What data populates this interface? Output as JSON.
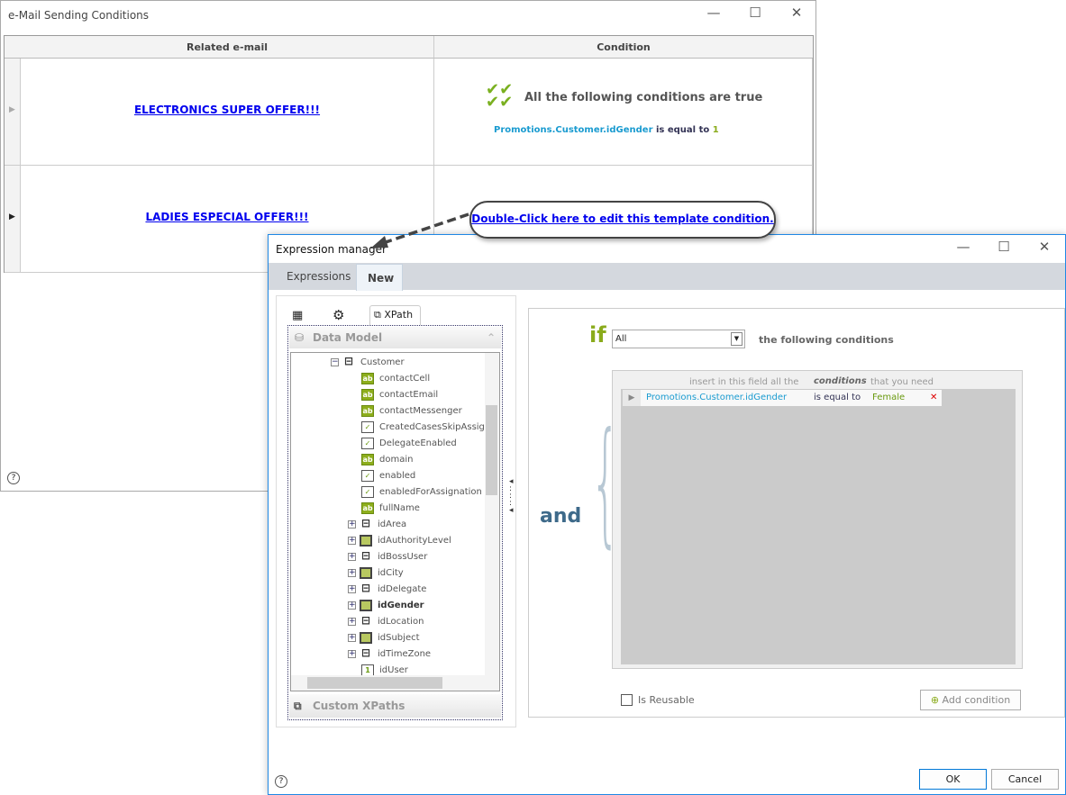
{
  "window1": {
    "title": "e-Mail Sending Conditions",
    "columns": [
      "Related e-mail",
      "Condition"
    ],
    "rows": [
      {
        "email": "ELECTRONICS SUPER OFFER!!!",
        "condition_title": "All the following conditions are true",
        "cond_field": "Promotions.Customer.idGender",
        "cond_op": "is equal to",
        "cond_value": "1"
      },
      {
        "email": "LADIES ESPECIAL OFFER!!!",
        "condition_link": "Double-Click here to edit this template condition."
      }
    ],
    "help": "?"
  },
  "window2": {
    "title": "Expression manager",
    "tabs": [
      "Expressions",
      "New"
    ],
    "active_tab": "New",
    "left_tabs": {
      "xpath": "XPath"
    },
    "data_model": "Data Model",
    "custom_xpaths": "Custom XPaths",
    "tree": {
      "root": "Customer",
      "items": [
        {
          "label": "contactCell",
          "icon": "ab"
        },
        {
          "label": "contactEmail",
          "icon": "ab"
        },
        {
          "label": "contactMessenger",
          "icon": "ab"
        },
        {
          "label": "CreatedCasesSkipAssigR",
          "icon": "check"
        },
        {
          "label": "DelegateEnabled",
          "icon": "check"
        },
        {
          "label": "domain",
          "icon": "ab"
        },
        {
          "label": "enabled",
          "icon": "check"
        },
        {
          "label": "enabledForAssignation",
          "icon": "check"
        },
        {
          "label": "fullName",
          "icon": "ab"
        },
        {
          "label": "idArea",
          "icon": "relation",
          "expandable": true
        },
        {
          "label": "idAuthorityLevel",
          "icon": "table",
          "expandable": true
        },
        {
          "label": "idBossUser",
          "icon": "relation",
          "expandable": true
        },
        {
          "label": "idCity",
          "icon": "table",
          "expandable": true
        },
        {
          "label": "idDelegate",
          "icon": "relation",
          "expandable": true
        },
        {
          "label": "idGender",
          "icon": "table",
          "expandable": true,
          "bold": true
        },
        {
          "label": "idLocation",
          "icon": "relation",
          "expandable": true
        },
        {
          "label": "idSubject",
          "icon": "table",
          "expandable": true
        },
        {
          "label": "idTimeZone",
          "icon": "relation",
          "expandable": true
        },
        {
          "label": "idUser",
          "icon": "number"
        }
      ]
    },
    "if_label": "if",
    "if_select": "All",
    "following": "the following conditions",
    "hint_a": "insert in this field all the",
    "hint_b": "conditions",
    "hint_c": "that you need",
    "condition": {
      "field": "Promotions.Customer.idGender",
      "op": "is equal to",
      "value": "Female"
    },
    "and_label": "and",
    "is_reusable": "Is Reusable",
    "is_reusable_checked": false,
    "add_condition": "Add condition",
    "ok": "OK",
    "cancel": "Cancel",
    "help": "?"
  },
  "colors": {
    "accent_blue": "#1e88e5",
    "field": "#1a9bd0",
    "green": "#8aab1c",
    "and": "#3e6a8a"
  }
}
